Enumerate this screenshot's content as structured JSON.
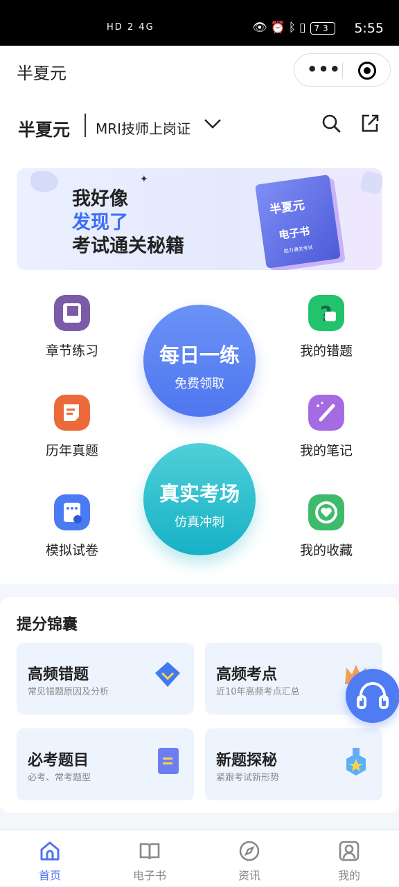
{
  "status_bar": {
    "time": "5:55",
    "battery": "73",
    "left_icons": "HD 2 4G",
    "right_icons": [
      "eye-icon",
      "alarm-icon",
      "bluetooth-icon",
      "vibrate-icon"
    ]
  },
  "app_bar": {
    "title": "半夏元",
    "menu_icon": "more-dots-icon",
    "close_icon": "target-icon"
  },
  "header": {
    "brand": "半夏元",
    "subject": "MRI技师上岗证",
    "search_icon": "search-icon",
    "share_icon": "share-icon"
  },
  "banner": {
    "line1": "我好像",
    "line2": "发现了",
    "line3": "考试通关秘籍",
    "book_title": "半夏元",
    "book_sub": "电子书",
    "book_note": "助力通关考试"
  },
  "grid": {
    "left": [
      {
        "label": "章节练习",
        "icon": "chapter-icon",
        "color": "#7b5aa6"
      },
      {
        "label": "历年真题",
        "icon": "history-icon",
        "color": "#ec6a3a"
      },
      {
        "label": "模拟试卷",
        "icon": "mock-paper-icon",
        "color": "#4a7bf2"
      }
    ],
    "right": [
      {
        "label": "我的错题",
        "icon": "wrong-question-icon",
        "color": "#23c26c"
      },
      {
        "label": "我的笔记",
        "icon": "notes-icon",
        "color": "#a56be3"
      },
      {
        "label": "我的收藏",
        "icon": "favorite-icon",
        "color": "#3dbb6a"
      }
    ],
    "daily": {
      "title": "每日一练",
      "sub": "免费领取"
    },
    "exam": {
      "title": "真实考场",
      "sub": "仿真冲刺"
    }
  },
  "tips": {
    "title": "提分锦囊",
    "cards": [
      {
        "title": "高频错题",
        "sub": "常见错题原因及分析",
        "icon": "diamond-icon"
      },
      {
        "title": "高频考点",
        "sub": "近10年高频考点汇总",
        "icon": "crown-icon"
      },
      {
        "title": "必考题目",
        "sub": "必考、常考题型",
        "icon": "book-icon"
      },
      {
        "title": "新题探秘",
        "sub": "紧跟考试新形势",
        "icon": "medal-icon"
      }
    ]
  },
  "float_button": {
    "icon": "headset-icon"
  },
  "tabbar": {
    "items": [
      {
        "label": "首页",
        "icon": "home-icon",
        "active": true
      },
      {
        "label": "电子书",
        "icon": "ebook-icon",
        "active": false
      },
      {
        "label": "资讯",
        "icon": "compass-icon",
        "active": false
      },
      {
        "label": "我的",
        "icon": "profile-icon",
        "active": false
      }
    ]
  },
  "colors": {
    "accent": "#4f76ef",
    "teal": "#16b1c6",
    "card_bg": "#eef4fe"
  }
}
